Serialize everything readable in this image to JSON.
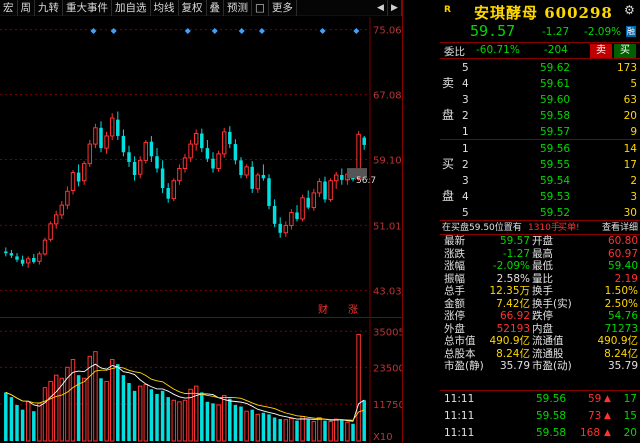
{
  "toolbar": {
    "items": [
      "宏",
      "周",
      "九转",
      "重大事件",
      "加自选",
      "均线",
      "复权",
      "叠",
      "预测",
      "□",
      "更多"
    ],
    "left_arrow": "◀",
    "right_arrow": "▶"
  },
  "chart": {
    "price_axis_labels": [
      "75.06",
      "67.08",
      "59.10",
      "51.01",
      "43.03"
    ],
    "volume_axis_labels": [
      "35005",
      "23500",
      "11750",
      "X10"
    ],
    "current_price_marker": "56.7",
    "event_markers": [
      "财",
      "涨"
    ],
    "colors": {
      "up": "#ff3232",
      "down": "#00e0e0",
      "ma5": "#ffffff",
      "ma10": "#ffd800",
      "ma20": "#ff00ff",
      "grid": "#800000",
      "marker": "#3fa0ff"
    }
  },
  "chart_data": {
    "type": "candlestick",
    "ylim": [
      40,
      76
    ],
    "candles": [
      [
        47.8,
        48.3,
        47.2,
        47.6
      ],
      [
        47.6,
        48.0,
        47.0,
        47.3
      ],
      [
        47.2,
        47.6,
        46.5,
        46.8
      ],
      [
        46.8,
        47.3,
        46.0,
        46.3
      ],
      [
        46.4,
        47.2,
        45.8,
        46.9
      ],
      [
        47.0,
        47.5,
        46.3,
        46.5
      ],
      [
        46.6,
        47.8,
        46.2,
        47.5
      ],
      [
        47.5,
        49.5,
        47.3,
        49.2
      ],
      [
        49.3,
        51.5,
        49.0,
        51.2
      ],
      [
        51.2,
        52.8,
        50.6,
        52.3
      ],
      [
        52.3,
        54.0,
        51.8,
        53.5
      ],
      [
        53.5,
        55.8,
        53.0,
        55.2
      ],
      [
        55.3,
        57.8,
        54.8,
        57.5
      ],
      [
        57.5,
        58.5,
        55.8,
        56.4
      ],
      [
        56.5,
        58.9,
        56.0,
        58.6
      ],
      [
        58.6,
        61.5,
        58.2,
        61.0
      ],
      [
        61.0,
        63.5,
        60.5,
        63.0
      ],
      [
        63.0,
        63.8,
        60.0,
        60.5
      ],
      [
        60.5,
        62.5,
        59.8,
        62.0
      ],
      [
        62.0,
        64.8,
        61.5,
        64.2
      ],
      [
        64.0,
        65.0,
        61.5,
        62.0
      ],
      [
        62.0,
        62.8,
        59.5,
        60.0
      ],
      [
        60.0,
        60.8,
        58.2,
        58.8
      ],
      [
        58.8,
        59.5,
        56.5,
        57.2
      ],
      [
        57.3,
        59.5,
        56.8,
        59.0
      ],
      [
        59.0,
        61.5,
        58.6,
        61.2
      ],
      [
        61.3,
        62.0,
        58.8,
        59.5
      ],
      [
        59.5,
        60.5,
        57.5,
        58.0
      ],
      [
        58.0,
        59.0,
        55.0,
        55.6
      ],
      [
        55.6,
        56.2,
        53.8,
        54.3
      ],
      [
        54.3,
        56.8,
        54.0,
        56.5
      ],
      [
        56.5,
        58.5,
        56.0,
        58.0
      ],
      [
        58.0,
        59.8,
        57.5,
        59.3
      ],
      [
        59.3,
        61.5,
        58.8,
        61.0
      ],
      [
        61.0,
        62.8,
        60.2,
        62.3
      ],
      [
        62.3,
        62.9,
        60.0,
        60.5
      ],
      [
        60.5,
        61.5,
        58.8,
        59.2
      ],
      [
        59.2,
        60.0,
        57.5,
        58.0
      ],
      [
        58.0,
        60.2,
        57.6,
        59.8
      ],
      [
        59.8,
        63.0,
        59.3,
        62.5
      ],
      [
        62.5,
        63.2,
        60.5,
        61.0
      ],
      [
        61.0,
        61.6,
        58.5,
        59.0
      ],
      [
        59.0,
        59.4,
        56.8,
        57.2
      ],
      [
        57.2,
        58.5,
        56.8,
        58.2
      ],
      [
        58.2,
        58.9,
        55.0,
        55.5
      ],
      [
        55.5,
        57.5,
        55.0,
        57.2
      ],
      [
        57.2,
        58.5,
        56.5,
        56.8
      ],
      [
        56.8,
        57.3,
        53.0,
        53.4
      ],
      [
        53.4,
        54.2,
        50.8,
        51.2
      ],
      [
        51.2,
        52.0,
        49.5,
        50.1
      ],
      [
        50.1,
        51.5,
        49.6,
        51.0
      ],
      [
        51.0,
        53.0,
        50.5,
        52.6
      ],
      [
        52.6,
        53.5,
        51.5,
        51.8
      ],
      [
        51.8,
        54.8,
        51.5,
        54.4
      ],
      [
        54.4,
        55.3,
        53.0,
        53.2
      ],
      [
        53.2,
        55.5,
        52.8,
        55.0
      ],
      [
        55.0,
        56.8,
        54.5,
        56.4
      ],
      [
        56.4,
        57.0,
        53.8,
        54.2
      ],
      [
        54.2,
        56.8,
        53.9,
        56.5
      ],
      [
        56.5,
        57.6,
        55.5,
        57.2
      ],
      [
        57.2,
        58.0,
        56.0,
        56.6
      ],
      [
        56.6,
        57.6,
        56.0,
        57.3
      ],
      [
        57.3,
        57.9,
        56.4,
        56.7
      ],
      [
        56.8,
        62.6,
        56.5,
        62.2
      ],
      [
        61.8,
        62.0,
        60.3,
        60.9
      ]
    ],
    "volume_ylim": [
      0,
      37000
    ],
    "volumes": [
      15500,
      14000,
      11500,
      10000,
      12500,
      9500,
      12000,
      17000,
      19000,
      21000,
      20000,
      23500,
      26000,
      21000,
      20000,
      27000,
      28500,
      20000,
      19000,
      26000,
      24500,
      21000,
      18500,
      16000,
      17500,
      18000,
      16500,
      15000,
      16000,
      14000,
      13000,
      12500,
      13000,
      16500,
      17500,
      15500,
      12500,
      12000,
      11500,
      14500,
      13500,
      11500,
      11000,
      9500,
      10000,
      8500,
      9000,
      8500,
      7500,
      7000,
      6800,
      7200,
      6500,
      7800,
      6800,
      6200,
      7500,
      6500,
      6200,
      7000,
      6800,
      6000,
      5500,
      34000,
      13000
    ]
  },
  "stock": {
    "badge": "R",
    "title": "安琪酵母 600298",
    "price": "59.57",
    "change": "-1.27",
    "change_pct": "-2.09%",
    "tag": "融",
    "settings_icon": "⚙"
  },
  "weibi": {
    "label": "委比",
    "pct": "-60.71%",
    "diff": "-204",
    "sell_btn": "卖",
    "buy_btn": "买"
  },
  "sell_book": [
    {
      "idx": "5",
      "price": "59.62",
      "vol": "173"
    },
    {
      "idx": "4",
      "price": "59.61",
      "vol": "5"
    },
    {
      "idx": "3",
      "price": "59.60",
      "vol": "63"
    },
    {
      "idx": "2",
      "price": "59.58",
      "vol": "20"
    },
    {
      "idx": "1",
      "price": "59.57",
      "vol": "9"
    }
  ],
  "sell_label": [
    "卖",
    "盘"
  ],
  "buy_book": [
    {
      "idx": "1",
      "price": "59.56",
      "vol": "14"
    },
    {
      "idx": "2",
      "price": "59.55",
      "vol": "17"
    },
    {
      "idx": "3",
      "price": "59.54",
      "vol": "2"
    },
    {
      "idx": "4",
      "price": "59.53",
      "vol": "3"
    },
    {
      "idx": "5",
      "price": "59.52",
      "vol": "30"
    }
  ],
  "buy_label": [
    "买",
    "盘"
  ],
  "notice": {
    "prefix": "在买盘59.50位置有",
    "amount": "1310手",
    "action": "买单!",
    "link": "查看详细"
  },
  "stats": [
    {
      "l1": "最新",
      "v1": "59.57",
      "c1": "green",
      "l2": "开盘",
      "v2": "60.80",
      "c2": "red"
    },
    {
      "l1": "涨跌",
      "v1": "-1.27",
      "c1": "green",
      "l2": "最高",
      "v2": "60.97",
      "c2": "red"
    },
    {
      "l1": "涨幅",
      "v1": "-2.09%",
      "c1": "green",
      "l2": "最低",
      "v2": "59.40",
      "c2": "green"
    },
    {
      "l1": "振幅",
      "v1": "2.58%",
      "c1": "white",
      "l2": "量比",
      "v2": "2.19",
      "c2": "red"
    },
    {
      "l1": "总手",
      "v1": "12.35万",
      "c1": "yellow",
      "l2": "换手",
      "v2": "1.50%",
      "c2": "yellow"
    },
    {
      "l1": "金额",
      "v1": "7.42亿",
      "c1": "yellow",
      "l2": "换手(实)",
      "v2": "2.50%",
      "c2": "yellow"
    },
    {
      "l1": "涨停",
      "v1": "66.92",
      "c1": "red",
      "l2": "跌停",
      "v2": "54.76",
      "c2": "green"
    },
    {
      "l1": "外盘",
      "v1": "52193",
      "c1": "red",
      "l2": "内盘",
      "v2": "71273",
      "c2": "green"
    },
    {
      "l1": "总市值",
      "v1": "490.9亿",
      "c1": "yellow",
      "l2": "流通值",
      "v2": "490.9亿",
      "c2": "yellow"
    },
    {
      "l1": "总股本",
      "v1": "8.24亿",
      "c1": "yellow",
      "l2": "流通股",
      "v2": "8.24亿",
      "c2": "yellow"
    },
    {
      "l1": "市盈(静)",
      "v1": "35.79",
      "c1": "white",
      "l2": "市盈(动)",
      "v2": "35.79",
      "c2": "white"
    }
  ],
  "ticks": [
    {
      "time": "11:11",
      "price": "59.56",
      "vol": "59",
      "cnt": "17"
    },
    {
      "time": "11:11",
      "price": "59.58",
      "vol": "73",
      "cnt": "15"
    },
    {
      "time": "11:11",
      "price": "59.58",
      "vol": "168",
      "cnt": "20"
    }
  ]
}
